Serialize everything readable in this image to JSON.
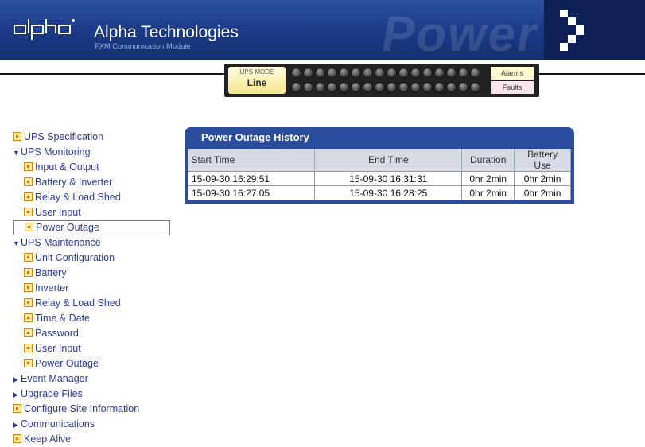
{
  "header": {
    "title": "Alpha Technologies",
    "subtitle": "FXM Communication Module",
    "watermark": "Power",
    "logo_text": "alpha"
  },
  "status": {
    "ups_mode_label": "UPS MODE",
    "ups_mode_value": "Line",
    "alarms_label": "Alarms",
    "faults_label": "Faults",
    "led_count_per_row": 16
  },
  "sidebar": {
    "items": [
      {
        "label": "UPS Specification",
        "icon": "doc-icon",
        "level": 0
      },
      {
        "label": "UPS Monitoring",
        "icon": "expanded-arrow",
        "level": 0
      },
      {
        "label": "Input & Output",
        "icon": "doc-icon",
        "level": 1
      },
      {
        "label": "Battery & Inverter",
        "icon": "doc-icon",
        "level": 1
      },
      {
        "label": "Relay & Load Shed",
        "icon": "doc-icon",
        "level": 1
      },
      {
        "label": "User Input",
        "icon": "doc-icon",
        "level": 1
      },
      {
        "label": "Power Outage",
        "icon": "doc-icon",
        "level": 1,
        "selected": true
      },
      {
        "label": "UPS Maintenance",
        "icon": "expanded-arrow",
        "level": 0
      },
      {
        "label": "Unit Configuration",
        "icon": "doc-icon",
        "level": 1
      },
      {
        "label": "Battery",
        "icon": "doc-icon",
        "level": 1
      },
      {
        "label": "Inverter",
        "icon": "doc-icon",
        "level": 1
      },
      {
        "label": "Relay & Load Shed",
        "icon": "doc-icon",
        "level": 1
      },
      {
        "label": "Time & Date",
        "icon": "doc-icon",
        "level": 1
      },
      {
        "label": "Password",
        "icon": "doc-icon",
        "level": 1
      },
      {
        "label": "User Input",
        "icon": "doc-icon",
        "level": 1
      },
      {
        "label": "Power Outage",
        "icon": "doc-icon",
        "level": 1
      },
      {
        "label": "Event Manager",
        "icon": "collapsed-arrow",
        "level": 0
      },
      {
        "label": "Upgrade Files",
        "icon": "collapsed-arrow",
        "level": 0
      },
      {
        "label": "Configure Site Information",
        "icon": "doc-icon",
        "level": 0
      },
      {
        "label": "Communications",
        "icon": "collapsed-arrow",
        "level": 0
      },
      {
        "label": "Keep Alive",
        "icon": "doc-icon",
        "level": 0
      }
    ]
  },
  "outage": {
    "title": "Power Outage History",
    "columns": [
      "Start Time",
      "End Time",
      "Duration",
      "Battery Use"
    ],
    "rows": [
      [
        "15-09-30 16:29:51",
        "15-09-30 16:31:31",
        "0hr 2min",
        "0hr 2min"
      ],
      [
        "15-09-30 16:27:05",
        "15-09-30 16:28:25",
        "0hr 2min",
        "0hr 2min"
      ]
    ]
  },
  "colors": {
    "header_blue": "#1b3a86",
    "panel_blue": "#2a4c9c",
    "link_blue": "#2b3a9a",
    "mode_yellow": "#f4e48a",
    "faults_pink": "#fde4ea"
  }
}
